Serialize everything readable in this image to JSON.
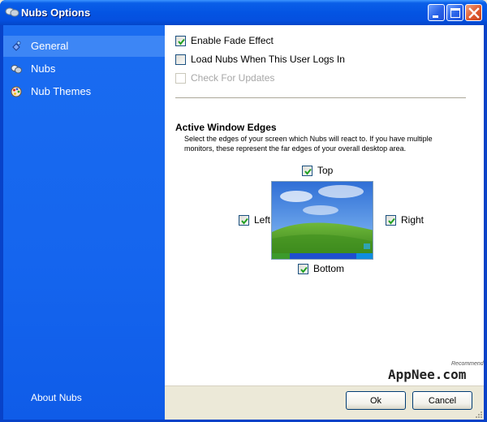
{
  "window": {
    "title": "Nubs Options",
    "controls": {
      "minimize": "minimize",
      "maximize": "maximize",
      "close": "close"
    }
  },
  "sidebar": {
    "items": [
      {
        "label": "General",
        "icon": "paint-bucket-icon",
        "selected": true
      },
      {
        "label": "Nubs",
        "icon": "nub-icon",
        "selected": false
      },
      {
        "label": "Nub Themes",
        "icon": "palette-icon",
        "selected": false
      }
    ],
    "about_label": "About Nubs"
  },
  "general": {
    "options": [
      {
        "label": "Enable Fade Effect",
        "checked": true,
        "enabled": true
      },
      {
        "label": "Load Nubs When This User Logs In",
        "checked": false,
        "enabled": true
      },
      {
        "label": "Check For Updates",
        "checked": false,
        "enabled": false
      }
    ],
    "edges_title": "Active Window Edges",
    "edges_description": "Select the edges of your screen which Nubs will react to. If you have multiple monitors, these represent the far edges of your overall desktop area.",
    "edges": {
      "top": {
        "label": "Top",
        "checked": true
      },
      "left": {
        "label": "Left",
        "checked": true
      },
      "right": {
        "label": "Right",
        "checked": true
      },
      "bottom": {
        "label": "Bottom",
        "checked": true
      }
    }
  },
  "footer": {
    "ok_label": "Ok",
    "cancel_label": "Cancel",
    "watermark": "AppNee.com",
    "watermark_small": "Recommend"
  },
  "colors": {
    "titlebar": "#0454e3",
    "sidebar": "#1565ee",
    "sidebar_selected": "#3d86f5",
    "checkbox_border": "#1c5180",
    "checkmark": "#21a121"
  }
}
